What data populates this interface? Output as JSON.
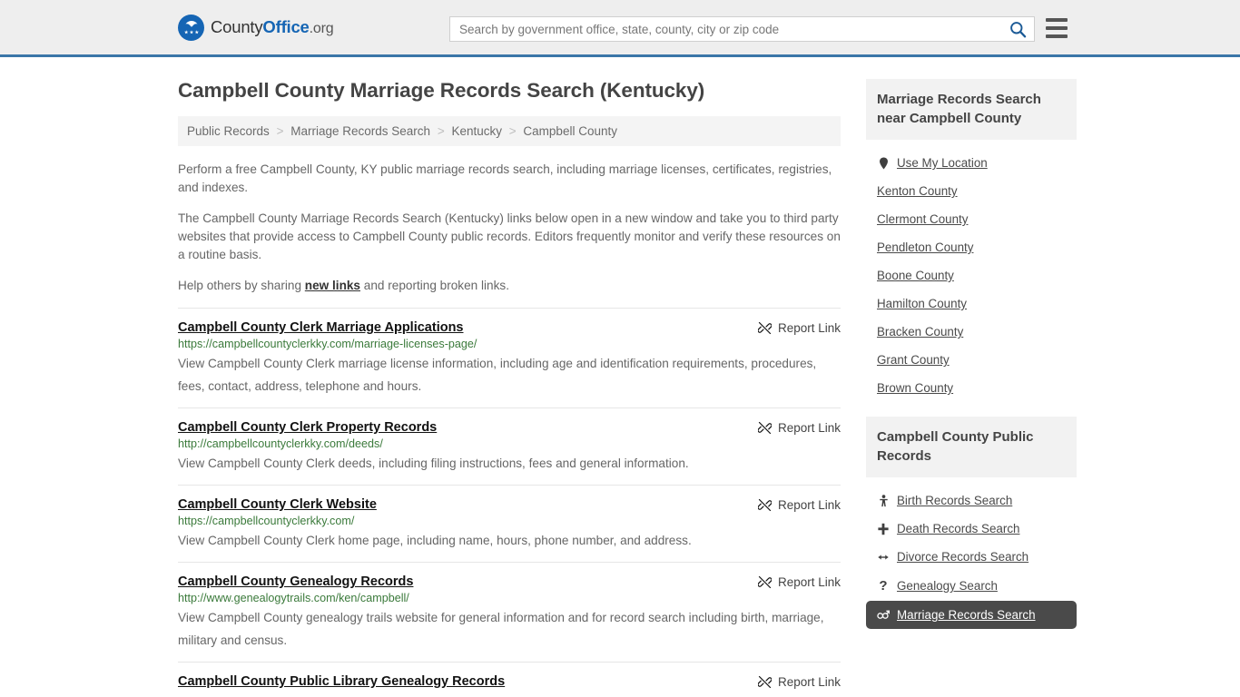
{
  "header": {
    "logo_text_1": "County",
    "logo_text_2": "Office",
    "logo_text_3": ".org",
    "search_placeholder": "Search by government office, state, county, city or zip code",
    "search_value": "",
    "search_icon": "search-icon",
    "menu_icon": "hamburger-menu-icon",
    "accent_color": "#3a76a8"
  },
  "main": {
    "title": "Campbell County Marriage Records Search (Kentucky)",
    "breadcrumb": [
      "Public Records",
      "Marriage Records Search",
      "Kentucky",
      "Campbell County"
    ],
    "breadcrumb_separator": ">",
    "intro_1": "Perform a free Campbell County, KY public marriage records search, including marriage licenses, certificates, registries, and indexes.",
    "intro_2": "The Campbell County Marriage Records Search (Kentucky) links below open in a new window and take you to third party websites that provide access to Campbell County public records. Editors frequently monitor and verify these resources on a routine basis.",
    "share_prefix": "Help others by sharing ",
    "share_link": "new links",
    "share_suffix": " and reporting broken links.",
    "report_link_label": "Report Link",
    "report_link_icon": "broken-link-icon",
    "results": [
      {
        "title": "Campbell County Clerk Marriage Applications",
        "url": "https://campbellcountyclerkky.com/marriage-licenses-page/",
        "desc": "View Campbell County Clerk marriage license information, including age and identification requirements, procedures, fees, contact, address, telephone and hours."
      },
      {
        "title": "Campbell County Clerk Property Records",
        "url": "http://campbellcountyclerkky.com/deeds/",
        "desc": "View Campbell County Clerk deeds, including filing instructions, fees and general information."
      },
      {
        "title": "Campbell County Clerk Website",
        "url": "https://campbellcountyclerkky.com/",
        "desc": "View Campbell County Clerk home page, including name, hours, phone number, and address."
      },
      {
        "title": "Campbell County Genealogy Records",
        "url": "http://www.genealogytrails.com/ken/campbell/",
        "desc": "View Campbell County genealogy trails website for general information and for record search including birth, marriage, military and census."
      },
      {
        "title": "Campbell County Public Library Genealogy Records",
        "url": "",
        "desc": ""
      }
    ]
  },
  "sidebar": {
    "nearby": {
      "heading": "Marriage Records Search near Campbell County",
      "items": [
        {
          "label": "Use My Location",
          "icon": "map-pin-icon"
        },
        {
          "label": "Kenton County",
          "icon": ""
        },
        {
          "label": "Clermont County",
          "icon": ""
        },
        {
          "label": "Pendleton County",
          "icon": ""
        },
        {
          "label": "Boone County",
          "icon": ""
        },
        {
          "label": "Hamilton County",
          "icon": ""
        },
        {
          "label": "Bracken County",
          "icon": ""
        },
        {
          "label": "Grant County",
          "icon": ""
        },
        {
          "label": "Brown County",
          "icon": ""
        }
      ]
    },
    "public_records": {
      "heading": "Campbell County Public Records",
      "items": [
        {
          "label": "Birth Records Search",
          "icon": "baby-icon",
          "active": false
        },
        {
          "label": "Death Records Search",
          "icon": "cross-icon",
          "active": false
        },
        {
          "label": "Divorce Records Search",
          "icon": "left-right-arrow-icon",
          "active": false
        },
        {
          "label": "Genealogy Search",
          "icon": "question-mark-icon",
          "active": false
        },
        {
          "label": "Marriage Records Search",
          "icon": "male-female-icon",
          "active": true
        }
      ]
    }
  }
}
